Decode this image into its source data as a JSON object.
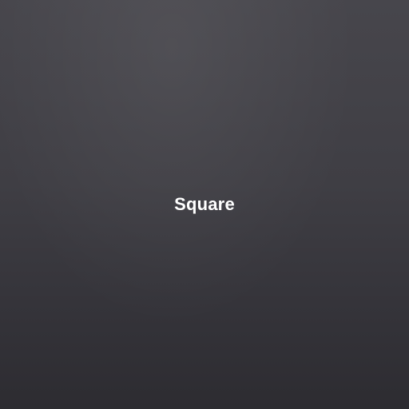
{
  "tile": {
    "label": "Square"
  },
  "colors": {
    "background_top": "#47464c",
    "background_bottom": "#2d2c31",
    "text": "#ffffff"
  }
}
